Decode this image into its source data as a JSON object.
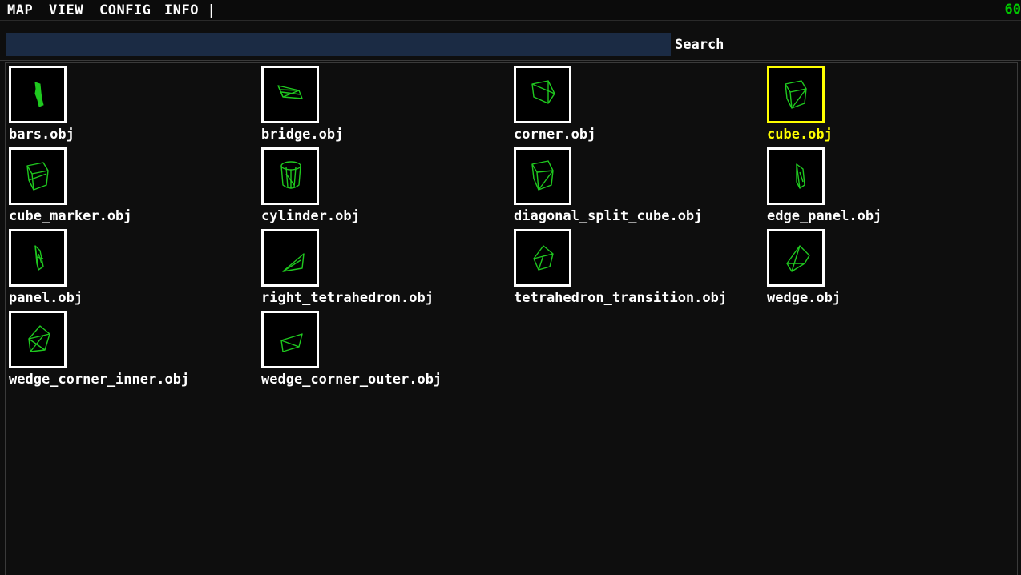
{
  "menubar": {
    "items": [
      {
        "label": "MAP"
      },
      {
        "label": "VIEW"
      },
      {
        "label": "CONFIG"
      },
      {
        "label": "INFO |"
      }
    ],
    "fps": "60"
  },
  "search": {
    "value": "",
    "label": "Search"
  },
  "browser": {
    "selected_index": 3,
    "items": [
      {
        "label": "bars.obj",
        "icon": "bars-model-icon"
      },
      {
        "label": "bridge.obj",
        "icon": "bridge-model-icon"
      },
      {
        "label": "corner.obj",
        "icon": "corner-model-icon"
      },
      {
        "label": "cube.obj",
        "icon": "cube-model-icon"
      },
      {
        "label": "cube_marker.obj",
        "icon": "cube-marker-model-icon"
      },
      {
        "label": "cylinder.obj",
        "icon": "cylinder-model-icon"
      },
      {
        "label": "diagonal_split_cube.obj",
        "icon": "diagonal-split-cube-model-icon"
      },
      {
        "label": "edge_panel.obj",
        "icon": "edge-panel-model-icon"
      },
      {
        "label": "panel.obj",
        "icon": "panel-model-icon"
      },
      {
        "label": "right_tetrahedron.obj",
        "icon": "right-tetrahedron-model-icon"
      },
      {
        "label": "tetrahedron_transition.obj",
        "icon": "tetrahedron-transition-model-icon"
      },
      {
        "label": "wedge.obj",
        "icon": "wedge-model-icon"
      },
      {
        "label": "wedge_corner_inner.obj",
        "icon": "wedge-corner-inner-model-icon"
      },
      {
        "label": "wedge_corner_outer.obj",
        "icon": "wedge-corner-outer-model-icon"
      }
    ]
  },
  "colors": {
    "background": "#0e0e0e",
    "search_field": "#1b2b44",
    "wireframe": "#1fc81f",
    "selection": "#ffff00",
    "fps": "#00c800"
  }
}
